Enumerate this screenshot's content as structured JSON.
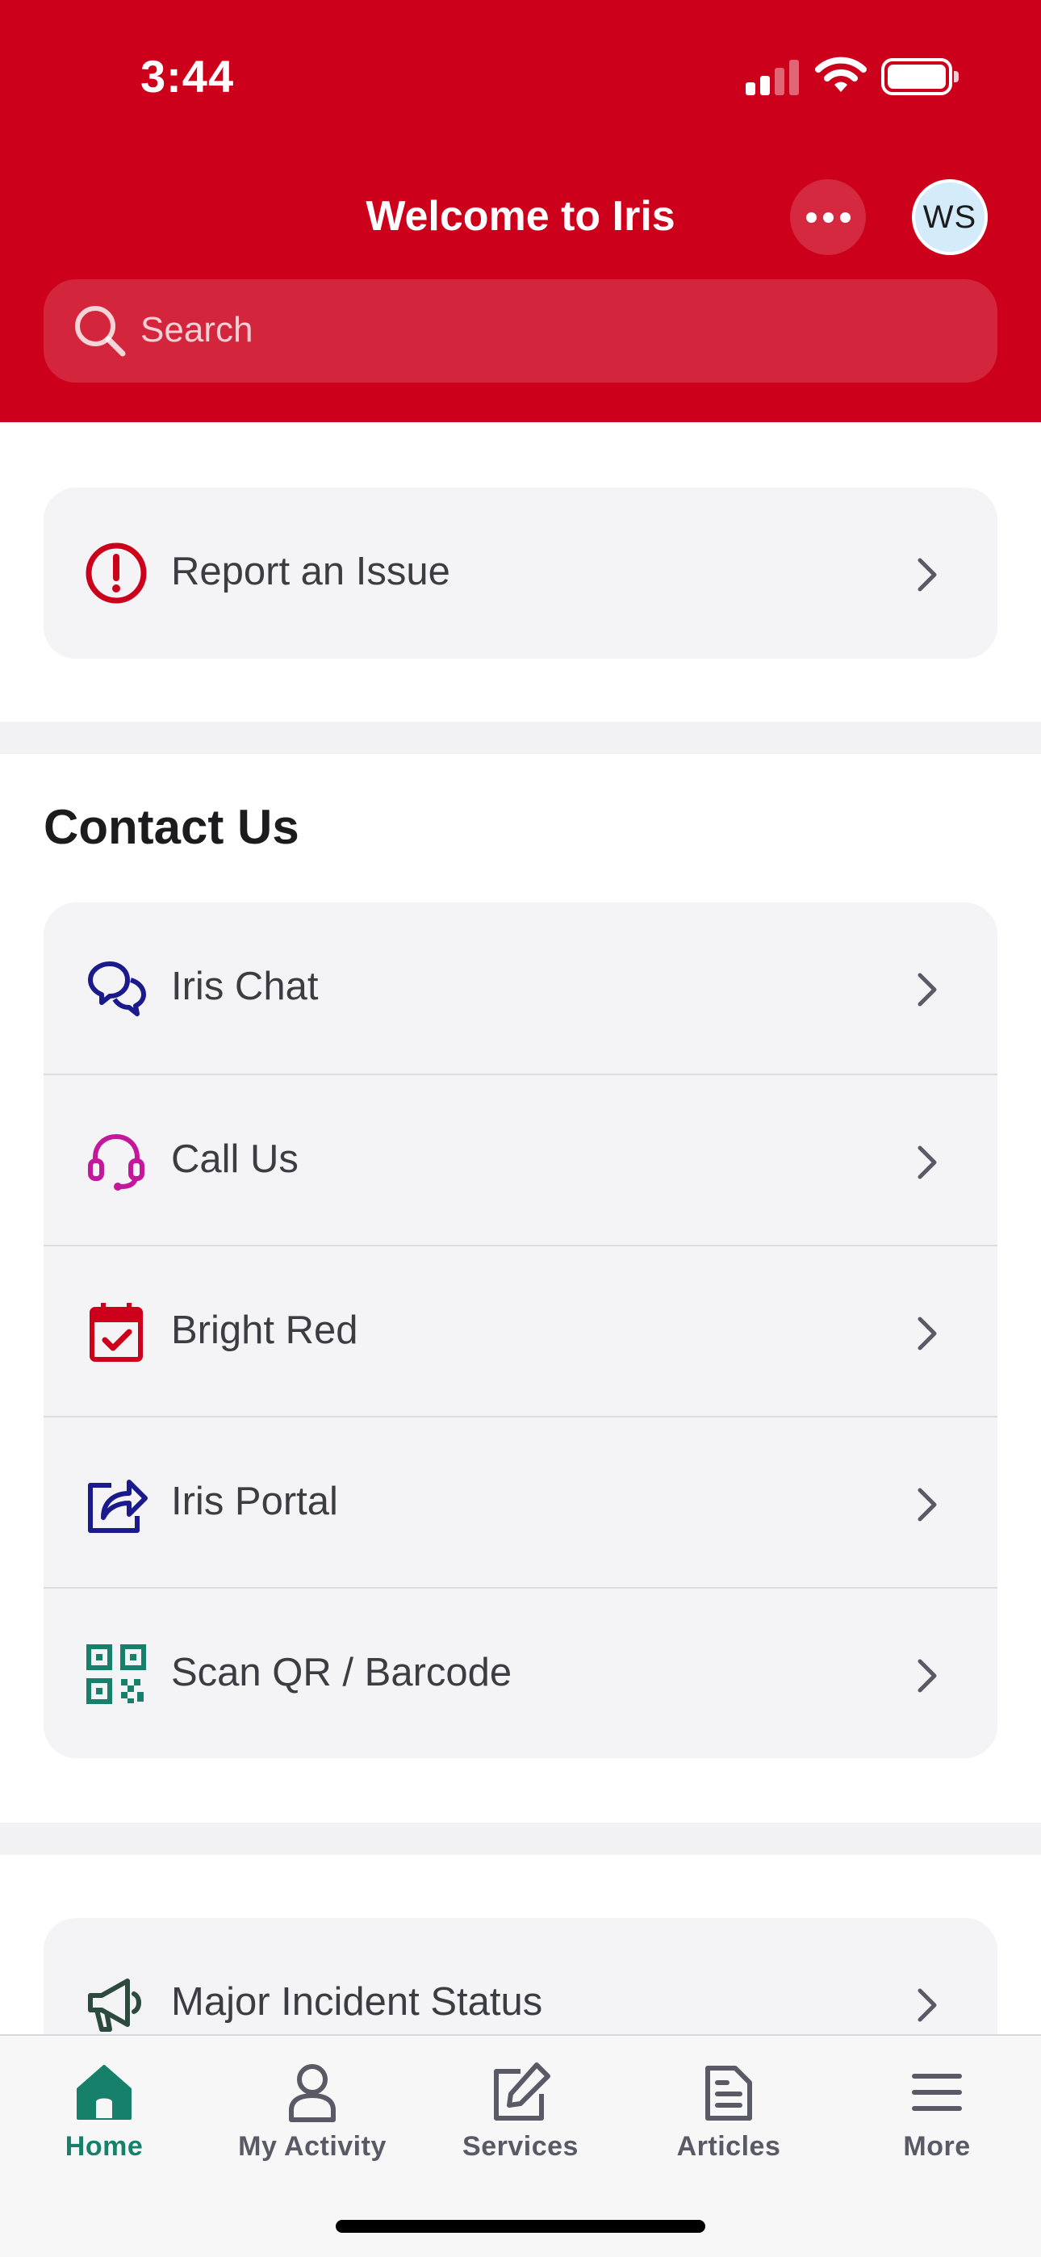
{
  "status_bar": {
    "time": "3:44"
  },
  "header": {
    "title": "Welcome to Iris",
    "avatar_initials": "WS",
    "search_placeholder": "Search",
    "bg_color": "#cc001a"
  },
  "report": {
    "label": "Report an Issue",
    "icon": "alert-circle-icon"
  },
  "contact": {
    "title": "Contact Us",
    "items": [
      {
        "label": "Iris Chat",
        "icon": "chat-bubbles-icon"
      },
      {
        "label": "Call Us",
        "icon": "headset-icon"
      },
      {
        "label": "Bright Red",
        "icon": "calendar-check-icon"
      },
      {
        "label": "Iris Portal",
        "icon": "share-arrow-icon"
      },
      {
        "label": "Scan QR / Barcode",
        "icon": "qr-code-icon"
      }
    ]
  },
  "incident": {
    "label": "Major Incident Status",
    "icon": "megaphone-icon"
  },
  "tabbar": {
    "items": [
      {
        "label": "Home",
        "icon": "home-icon",
        "active": true
      },
      {
        "label": "My Activity",
        "icon": "person-icon",
        "active": false
      },
      {
        "label": "Services",
        "icon": "edit-icon",
        "active": false
      },
      {
        "label": "Articles",
        "icon": "document-icon",
        "active": false
      },
      {
        "label": "More",
        "icon": "menu-icon",
        "active": false
      }
    ],
    "active_color": "#16806a"
  }
}
